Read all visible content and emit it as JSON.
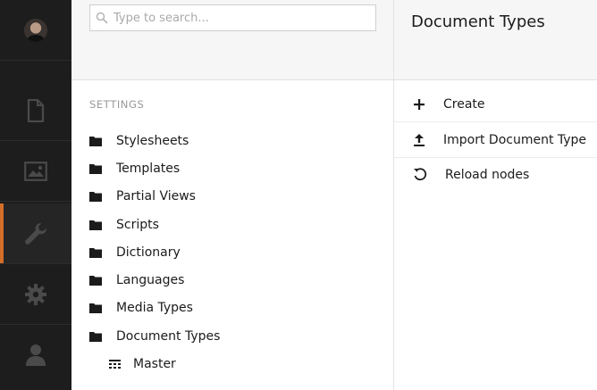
{
  "nav": {
    "items": [
      {
        "icon": "user-avatar",
        "active": false
      },
      {
        "icon": "document-icon",
        "active": false
      },
      {
        "icon": "image-icon",
        "active": false
      },
      {
        "icon": "wrench-icon",
        "active": true
      },
      {
        "icon": "gear-icon",
        "active": false
      },
      {
        "icon": "person-icon",
        "active": false
      }
    ],
    "active_accent": "#d36e2a"
  },
  "search": {
    "placeholder": "Type to search...",
    "value": ""
  },
  "tree": {
    "section_title": "SETTINGS",
    "items": [
      {
        "label": "Stylesheets"
      },
      {
        "label": "Templates"
      },
      {
        "label": "Partial Views"
      },
      {
        "label": "Scripts"
      },
      {
        "label": "Dictionary"
      },
      {
        "label": "Languages"
      },
      {
        "label": "Media Types"
      },
      {
        "label": "Document Types"
      }
    ],
    "children": [
      {
        "label": "Master"
      }
    ]
  },
  "actions": {
    "title": "Document Types",
    "items": [
      {
        "label": "Create",
        "icon": "plus-icon"
      },
      {
        "label": "Import Document Type",
        "icon": "upload-icon"
      },
      {
        "label": "Reload nodes",
        "icon": "reload-icon"
      }
    ]
  }
}
